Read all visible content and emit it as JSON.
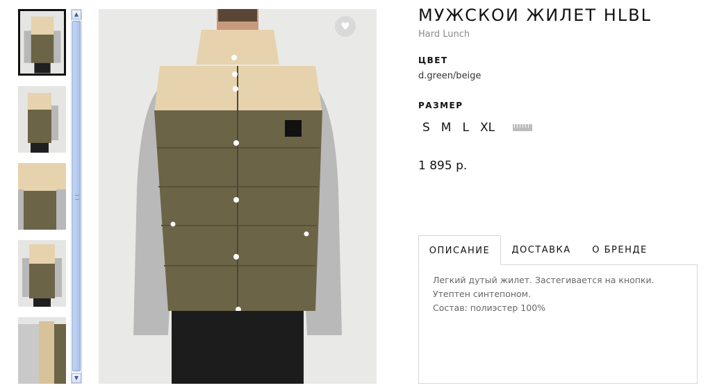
{
  "product": {
    "title": "МУЖСКОИ ЖИЛЕТ HLBL",
    "brand": "Hard Lunch",
    "color_label": "ЦВЕТ",
    "color_value": "d.green/beige",
    "size_label": "РАЗМЕР",
    "sizes": [
      "S",
      "M",
      "L",
      "XL"
    ],
    "price": "1 895 р."
  },
  "tabs": [
    {
      "label": "ОПИСАНИЕ",
      "active": true
    },
    {
      "label": "ДОСТАВКА",
      "active": false
    },
    {
      "label": "О БРЕНДЕ",
      "active": false
    }
  ],
  "description": {
    "line1": "Легкий дутый жилет. Застегивается на кнопки. Утептен синтепоном.",
    "line2": "Состав: полиэстер 100%"
  },
  "icons": {
    "favorite": "heart-icon",
    "size_chart": "ruler-icon",
    "scroll_up": "chevron-up-icon",
    "scroll_down": "chevron-down-icon"
  },
  "colors": {
    "vest_olive": "#6b6447",
    "vest_beige": "#e6d2ad",
    "sleeve_grey": "#b9b9b9",
    "scrollbar_accent": "#a9c0ea"
  }
}
